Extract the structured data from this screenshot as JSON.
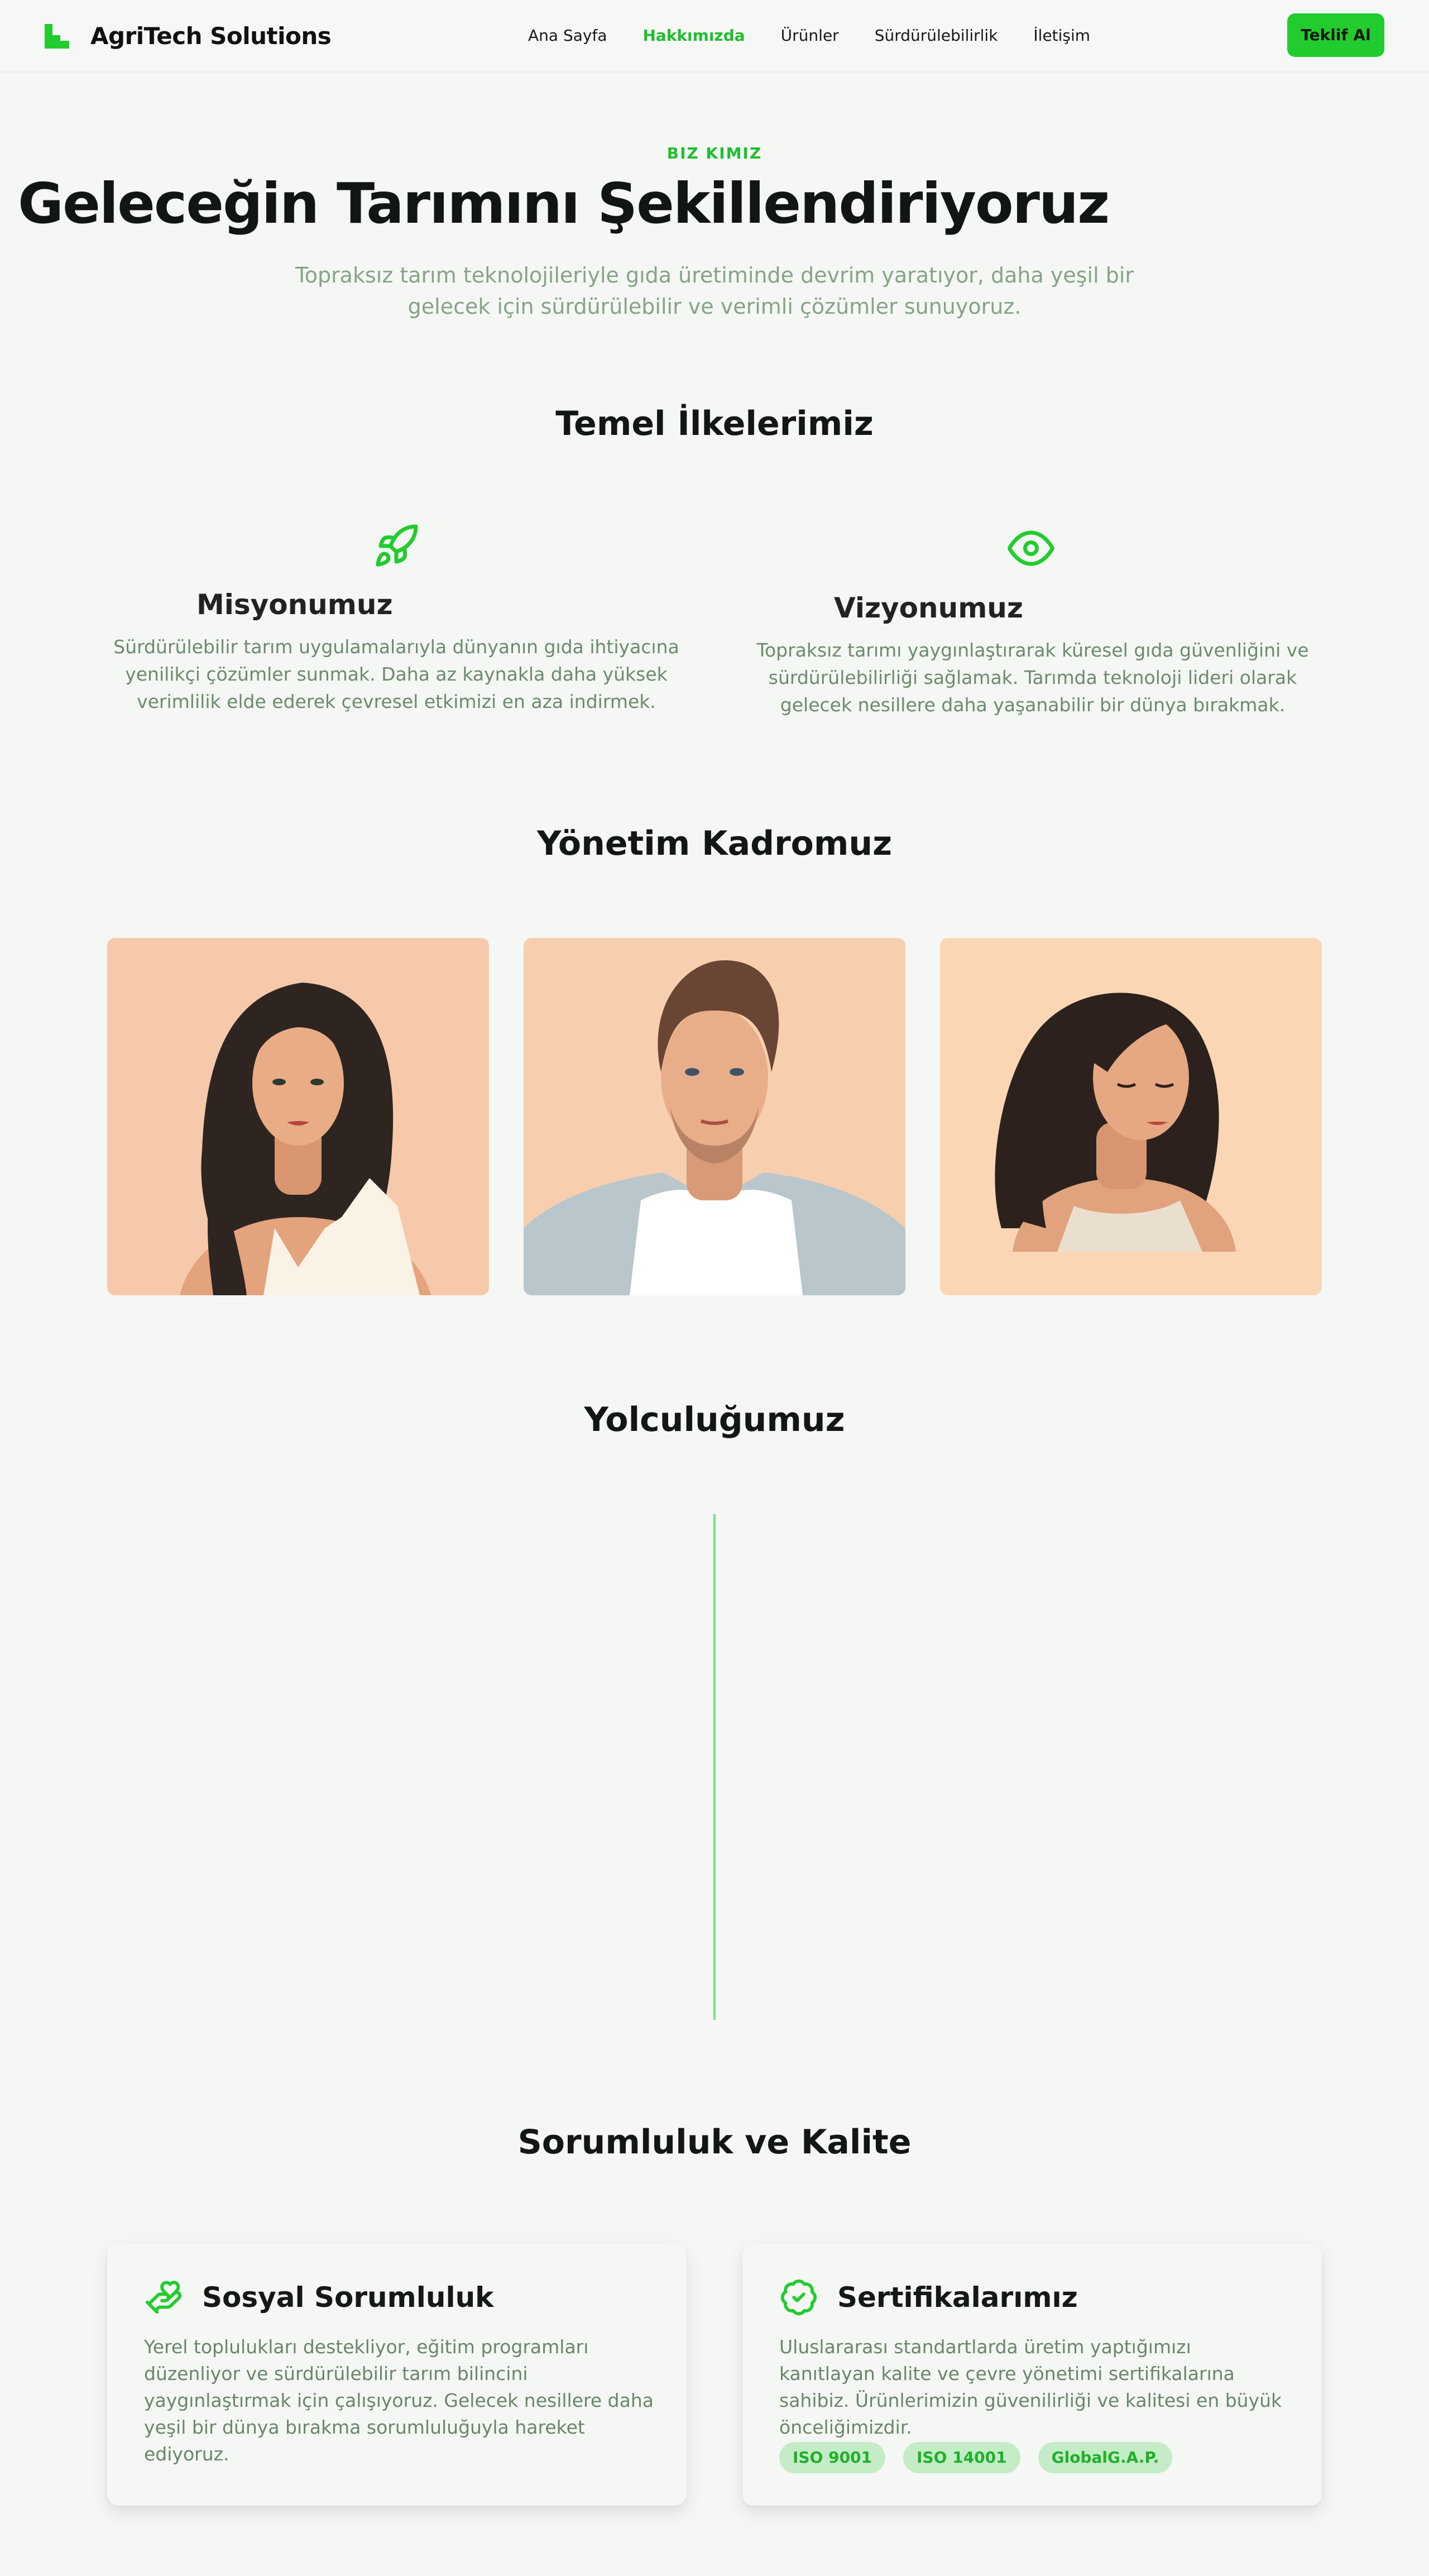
{
  "header": {
    "brand": "AgriTech Solutions",
    "nav": [
      "Ana Sayfa",
      "Hakkımızda",
      "Ürünler",
      "Sürdürülebilirlik",
      "İletişim"
    ],
    "active_nav": "Hakkımızda",
    "cta_label": "Teklif Al"
  },
  "hero": {
    "eyebrow": "BIZ KIMIZ",
    "title": "Geleceğin Tarımını Şekillendiriyoruz",
    "subtitle": "Topraksız tarım teknolojileriyle gıda üretiminde devrim yaratıyor, daha yeşil bir gelecek için sürdürülebilir ve verimli çözümler sunuyoruz."
  },
  "principles": {
    "title": "Temel İlkelerimiz",
    "mission": {
      "icon": "rocket-icon",
      "title": "Misyonumuz",
      "text": "Sürdürülebilir tarım uygulamalarıyla dünyanın gıda ihtiyacına yenilikçi çözümler sunmak. Daha az kaynakla daha yüksek verimlilik elde ederek çevresel etkimizi en aza indirmek."
    },
    "vision": {
      "icon": "eye-icon",
      "title": "Vizyonumuz",
      "text": "Topraksız tarımı yaygınlaştırarak küresel gıda güvenliğini ve sürdürülebilirliği sağlamak. Tarımda teknoloji lideri olarak gelecek nesillere daha yaşanabilir bir dünya bırakmak."
    }
  },
  "team": {
    "title": "Yönetim Kadromuz"
  },
  "journey": {
    "title": "Yolculuğumuz"
  },
  "quality": {
    "title": "Sorumluluk ve Kalite",
    "social": {
      "icon": "hand-heart-icon",
      "title": "Sosyal Sorumluluk",
      "text": "Yerel toplulukları destekliyor, eğitim programları düzenliyor ve sürdürülebilir tarım bilincini yaygınlaştırmak için çalışıyoruz. Gelecek nesillere daha yeşil bir dünya bırakma sorumluluğuyla hareket ediyoruz."
    },
    "certs": {
      "icon": "badge-check-icon",
      "title": "Sertifikalarımız",
      "text": "Uluslararası standartlarda üretim yaptığımızı kanıtlayan kalite ve çevre yönetimi sertifikalarına sahibiz. Ürünlerimizin güvenilirliği ve kalitesi en büyük önceliğimizdir.",
      "badges": [
        "ISO 9001",
        "ISO 14001",
        "GlobalG.A.P."
      ]
    }
  },
  "colors": {
    "accent": "#22cc2e",
    "background": "#f4f7f4",
    "muted_text": "#87a387"
  }
}
